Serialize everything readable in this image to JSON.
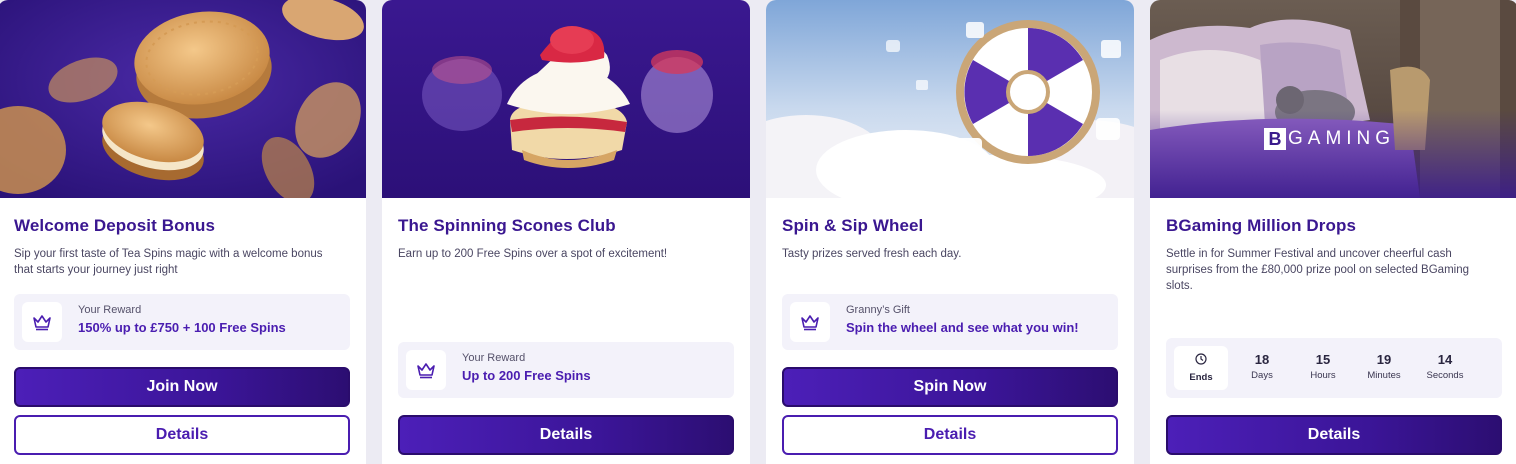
{
  "cards": [
    {
      "title": "Welcome Deposit Bonus",
      "description": "Sip your first taste of Tea Spins magic with a welcome bonus that starts your journey just right",
      "reward": {
        "label": "Your Reward",
        "value": "150% up to £750 + 100 Free Spins",
        "icon": "crown-icon"
      },
      "primary_button": "Join Now",
      "secondary_button": "Details"
    },
    {
      "title": "The Spinning Scones Club",
      "description": "Earn up to 200 Free Spins over a spot of excitement!",
      "reward": {
        "label": "Your Reward",
        "value": "Up to 200 Free Spins",
        "icon": "crown-icon"
      },
      "primary_button": "Details"
    },
    {
      "title": "Spin & Sip Wheel",
      "description": "Tasty prizes served fresh each day.",
      "reward": {
        "label": "Granny’s Gift",
        "value": "Spin the wheel and see what you win!",
        "icon": "crown-icon"
      },
      "primary_button": "Spin Now",
      "secondary_button": "Details"
    },
    {
      "title": "BGaming Million Drops",
      "description": "Settle in for Summer Festival and uncover cheerful cash surprises from the £80,000 prize pool on selected BGaming slots.",
      "brand_logo": "BGAMING",
      "countdown": {
        "ends_label": "Ends",
        "days": "18",
        "days_label": "Days",
        "hours": "15",
        "hours_label": "Hours",
        "minutes": "19",
        "minutes_label": "Minutes",
        "seconds": "14",
        "seconds_label": "Seconds"
      },
      "primary_button": "Details"
    }
  ],
  "colors": {
    "accent": "#4a1db0",
    "hero_purple": "#3a1b8c",
    "page_bg": "#ecebf3"
  }
}
